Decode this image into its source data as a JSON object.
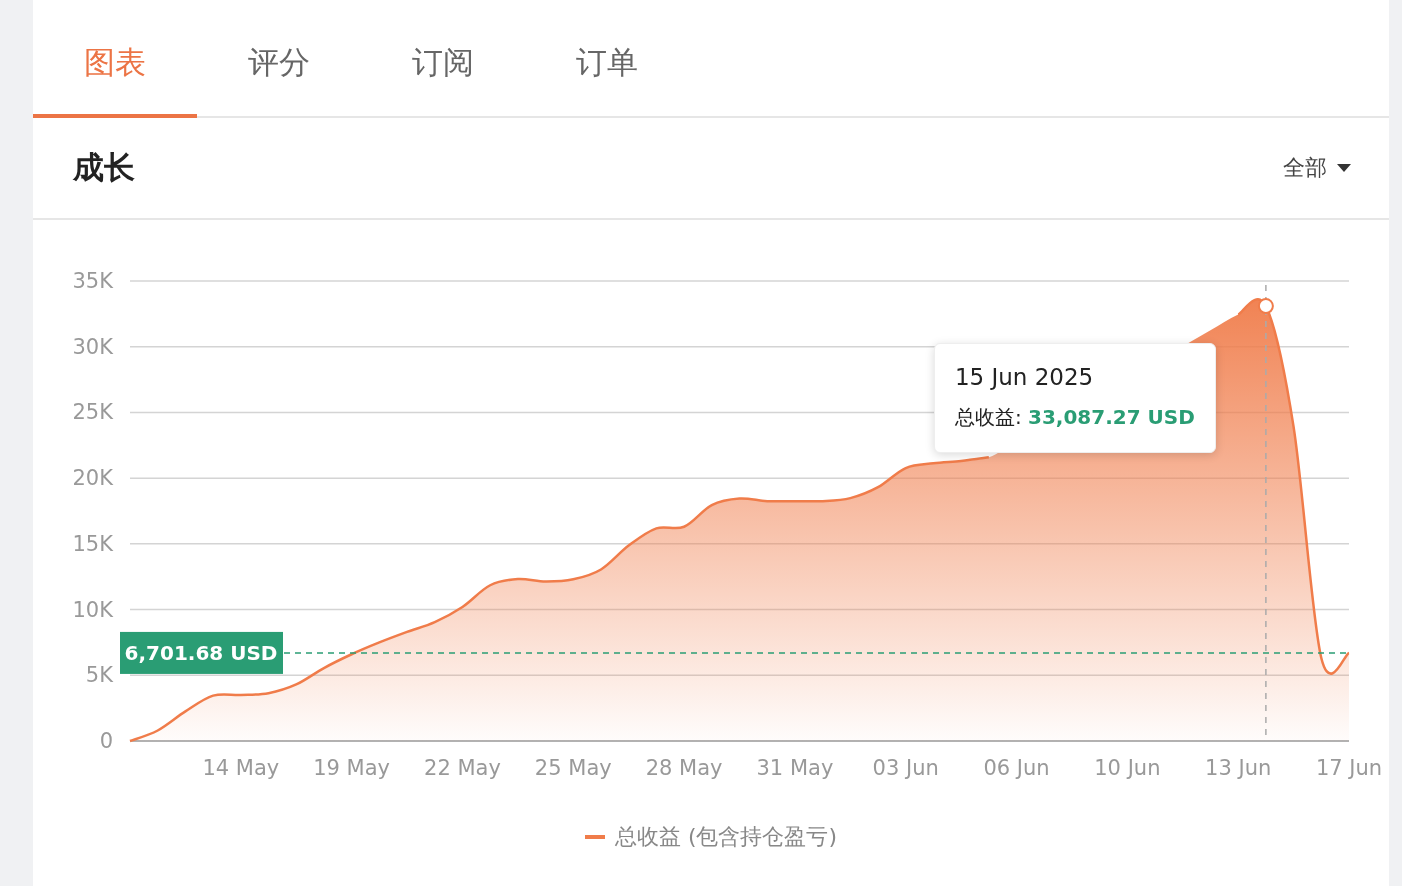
{
  "tabs": [
    {
      "label": "图表",
      "selected": true
    },
    {
      "label": "评分",
      "selected": false
    },
    {
      "label": "订阅",
      "selected": false
    },
    {
      "label": "订单",
      "selected": false
    }
  ],
  "section": {
    "title": "成长",
    "filter": "全部"
  },
  "chart_data": {
    "type": "area",
    "categories": [
      null,
      null,
      null,
      null,
      "14 May",
      null,
      null,
      null,
      "19 May",
      null,
      null,
      null,
      "22 May",
      null,
      null,
      null,
      "25 May",
      null,
      null,
      null,
      "28 May",
      null,
      null,
      null,
      "31 May",
      null,
      null,
      null,
      "03 Jun",
      null,
      null,
      null,
      "06 Jun",
      null,
      null,
      null,
      "10 Jun",
      null,
      null,
      null,
      "13 Jun",
      null,
      null,
      null,
      "17 Jun"
    ],
    "series": [
      {
        "name": "总收益 (包含持仓盈亏)",
        "color": "#f07c4a",
        "values": [
          0,
          800,
          2250,
          3450,
          3500,
          3640,
          4300,
          5550,
          6600,
          7500,
          8300,
          9050,
          10200,
          11850,
          12320,
          12130,
          12300,
          13050,
          14870,
          16180,
          16300,
          17950,
          18450,
          18250,
          18250,
          18250,
          18480,
          19310,
          20770,
          21130,
          21310,
          21590,
          null,
          null,
          null,
          null,
          null,
          null,
          null,
          null,
          32450,
          33090,
          23900,
          6320,
          6700
        ]
      }
    ],
    "ylim": [
      0,
      35000
    ],
    "grid": true,
    "yticks": [
      {
        "value": 0,
        "label": "0"
      },
      {
        "value": 5000,
        "label": "5K"
      },
      {
        "value": 10000,
        "label": "10K"
      },
      {
        "value": 15000,
        "label": "15K"
      },
      {
        "value": 20000,
        "label": "20K"
      },
      {
        "value": 25000,
        "label": "25K"
      },
      {
        "value": 30000,
        "label": "30K"
      },
      {
        "value": 35000,
        "label": "35K"
      }
    ],
    "ref_lines": [
      {
        "axis": "y",
        "value": 6701.68,
        "label": "6,701.68 USD",
        "color": "#2a9d74"
      }
    ]
  },
  "tooltip": {
    "date": "15 Jun 2025",
    "label": "总收益:",
    "value": "33,087.27 USD"
  }
}
